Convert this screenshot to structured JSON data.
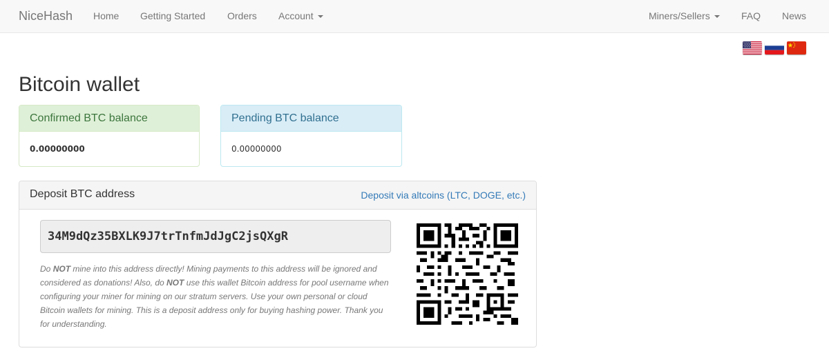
{
  "navbar": {
    "brand": "NiceHash",
    "left_items": [
      {
        "label": "Home"
      },
      {
        "label": "Getting Started"
      },
      {
        "label": "Orders"
      },
      {
        "label": "Account"
      }
    ],
    "right_items": [
      {
        "label": "Miners/Sellers"
      },
      {
        "label": "FAQ"
      },
      {
        "label": "News"
      }
    ]
  },
  "languages": [
    {
      "icon": "us-flag-icon"
    },
    {
      "icon": "russia-flag-icon"
    },
    {
      "icon": "china-flag-icon"
    }
  ],
  "page": {
    "title": "Bitcoin wallet"
  },
  "balances": {
    "confirmed": {
      "label": "Confirmed BTC balance",
      "value": "0.00000000"
    },
    "pending": {
      "label": "Pending BTC balance",
      "value": "0.00000000"
    }
  },
  "deposit": {
    "title": "Deposit BTC address",
    "altcoin_link": "Deposit via altcoins (LTC, DOGE, etc.)",
    "address": "34M9dQz35BXLK9J7trTnfmJdJgC2jsQXgR",
    "note": {
      "p1": "Do ",
      "b1": "NOT",
      "p2": " mine into this address directly! Mining payments to this address will be ignored and considered as donations! Also, do ",
      "b2": "NOT",
      "p3": " use this wallet Bitcoin address for pool username when configuring your miner for mining on our stratum servers. Use your own personal or cloud Bitcoin wallets for mining. This is a deposit address only for buying hashing power. Thank you for understanding."
    },
    "qr_icon": "qr-code-icon"
  },
  "colors": {
    "navbar_bg": "#f8f8f8",
    "link": "#337ab7",
    "success_bg": "#dff0d8",
    "success_text": "#3c763d",
    "info_bg": "#d9edf7",
    "info_text": "#31708f"
  }
}
